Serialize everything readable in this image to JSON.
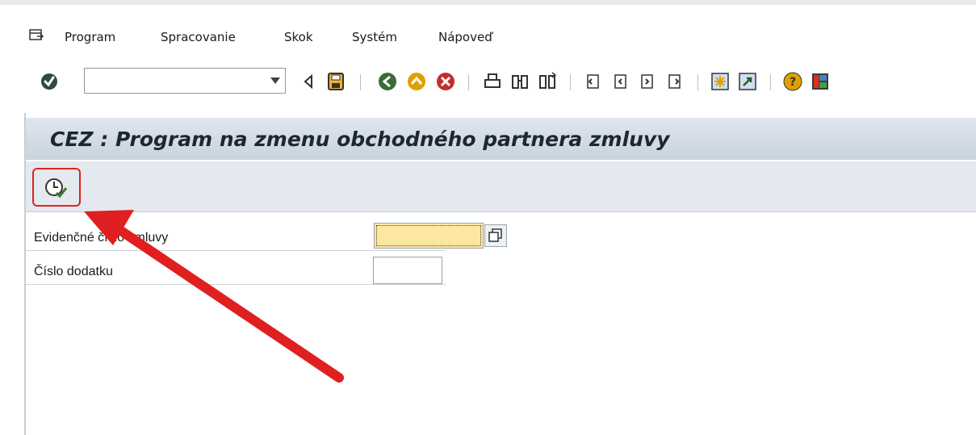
{
  "menu": {
    "items": [
      "Program",
      "Spracovanie",
      "Skok",
      "Systém",
      "Nápoveď"
    ]
  },
  "toolbar": {
    "command_value": "",
    "buttons": [
      {
        "icon": "enter-check-icon"
      },
      {
        "icon": "back-triangle-icon"
      },
      {
        "icon": "save-icon"
      },
      {
        "icon": "back-icon"
      },
      {
        "icon": "exit-icon"
      },
      {
        "icon": "cancel-icon"
      },
      {
        "icon": "print-icon"
      },
      {
        "icon": "find-icon"
      },
      {
        "icon": "find-next-icon"
      },
      {
        "icon": "first-page-icon"
      },
      {
        "icon": "previous-page-icon"
      },
      {
        "icon": "next-page-icon"
      },
      {
        "icon": "last-page-icon"
      },
      {
        "icon": "new-session-icon"
      },
      {
        "icon": "shortcut-icon"
      },
      {
        "icon": "help-icon"
      },
      {
        "icon": "layout-menu-icon"
      }
    ]
  },
  "screen": {
    "title": "CEZ : Program na zmenu obchodného partnera zmluvy",
    "execute_button": {
      "icon": "execute-clock-icon",
      "highlighted": true
    }
  },
  "form": {
    "fields": [
      {
        "label": "Evidenčné číslo zmluvy",
        "value": ""
      },
      {
        "label": "Číslo dodatku",
        "value": ""
      }
    ]
  },
  "colors": {
    "title_bg": "#c8d3de",
    "required_field": "#fde7a0",
    "annotation": "#e02020"
  }
}
